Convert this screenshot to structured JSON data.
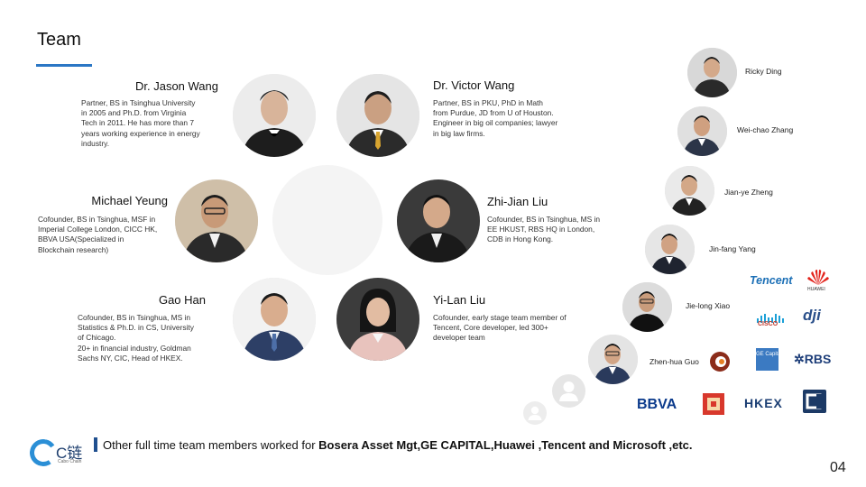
{
  "title": "Team",
  "partners": [
    {
      "name": "Dr. Jason Wang",
      "desc": "Partner, BS in Tsinghua University\nin 2005 and Ph.D. from Virginia\nTech in 2011.  He has more than 7\nyears working experience in energy\nindustry."
    },
    {
      "name": "Dr. Victor Wang",
      "desc": "Partner, BS in PKU, PhD in Math\nfrom Purdue, JD from U of Houston.\nEngineer in big oil companies; lawyer\nin big law firms."
    },
    {
      "name": "Michael Yeung",
      "desc": "Cofounder, BS in Tsinghua, MSF in\nImperial College London, CICC HK,\nBBVA USA(Specialized in\nBlockchain research)"
    },
    {
      "name": "Zhi-Jian Liu",
      "desc": "Cofounder, BS in Tsinghua, MS in\nEE HKUST, RBS HQ in London,\nCDB in Hong Kong."
    },
    {
      "name": "Gao Han",
      "desc": "Cofounder, BS in Tsinghua, MS in\nStatistics & Ph.D. in CS, University\nof Chicago.\n20+ in financial industry, Goldman\nSachs NY, CIC, Head of HKEX."
    },
    {
      "name": "Yi-Lan Liu",
      "desc": "Cofounder, early stage team member of\nTencent, Core developer, led 300+\ndeveloper team"
    }
  ],
  "members": [
    {
      "name": "Ricky Ding"
    },
    {
      "name": "Wei-chao Zhang"
    },
    {
      "name": "Jian-ye Zheng"
    },
    {
      "name": "Jin-fang Yang"
    },
    {
      "name": "Jie-long Xiao"
    },
    {
      "name": "Zhen-hua Guo"
    }
  ],
  "logos": {
    "tencent": "Tencent",
    "huawei": "HUAWEI",
    "cisco": "CISCO",
    "dji": "dji",
    "ge_capital": "GE Capital",
    "rbs": "RBS",
    "bbva": "BBVA",
    "hkex": "HKEX"
  },
  "footer": {
    "prefix": "Other full time team members worked for ",
    "bold": "Bosera Asset Mgt,GE CAPITAL,Huawei ,Tencent and Microsoft ,etc."
  },
  "brand": {
    "name": "C链",
    "sub": "Cabo Chain"
  },
  "page_number": "04",
  "colors": {
    "accent": "#2b77c5",
    "footer_bar": "#1f4f8f",
    "brand": "#2b8fd6"
  }
}
